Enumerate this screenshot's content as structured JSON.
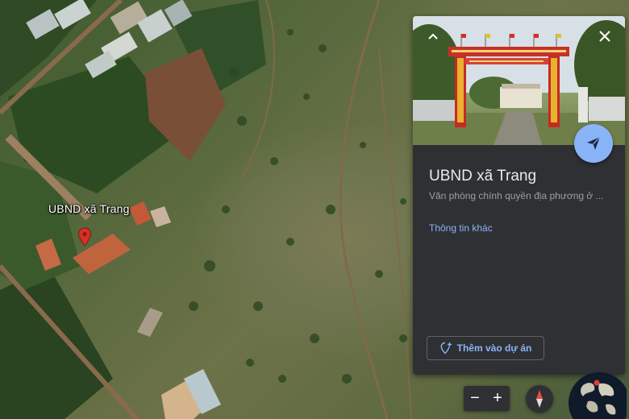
{
  "map": {
    "place_label": "UBND xã Trang",
    "pin_icon": "map-pin-icon",
    "pin_color": "#d93025"
  },
  "panel": {
    "title": "UBND xã Trang",
    "subtitle": "Văn phòng chính quyền địa phương ở ...",
    "more_info_link": "Thông tin khác",
    "add_to_project_label": "Thêm vào dự án",
    "accent_color": "#8ab4f8",
    "photo_controls": {
      "collapse_icon": "chevron-up-icon",
      "close_icon": "close-icon"
    },
    "send_icon": "send-icon"
  },
  "controls": {
    "zoom_out_label": "−",
    "zoom_in_label": "+",
    "compass_icon": "compass-icon",
    "globe_icon": "globe-icon"
  }
}
